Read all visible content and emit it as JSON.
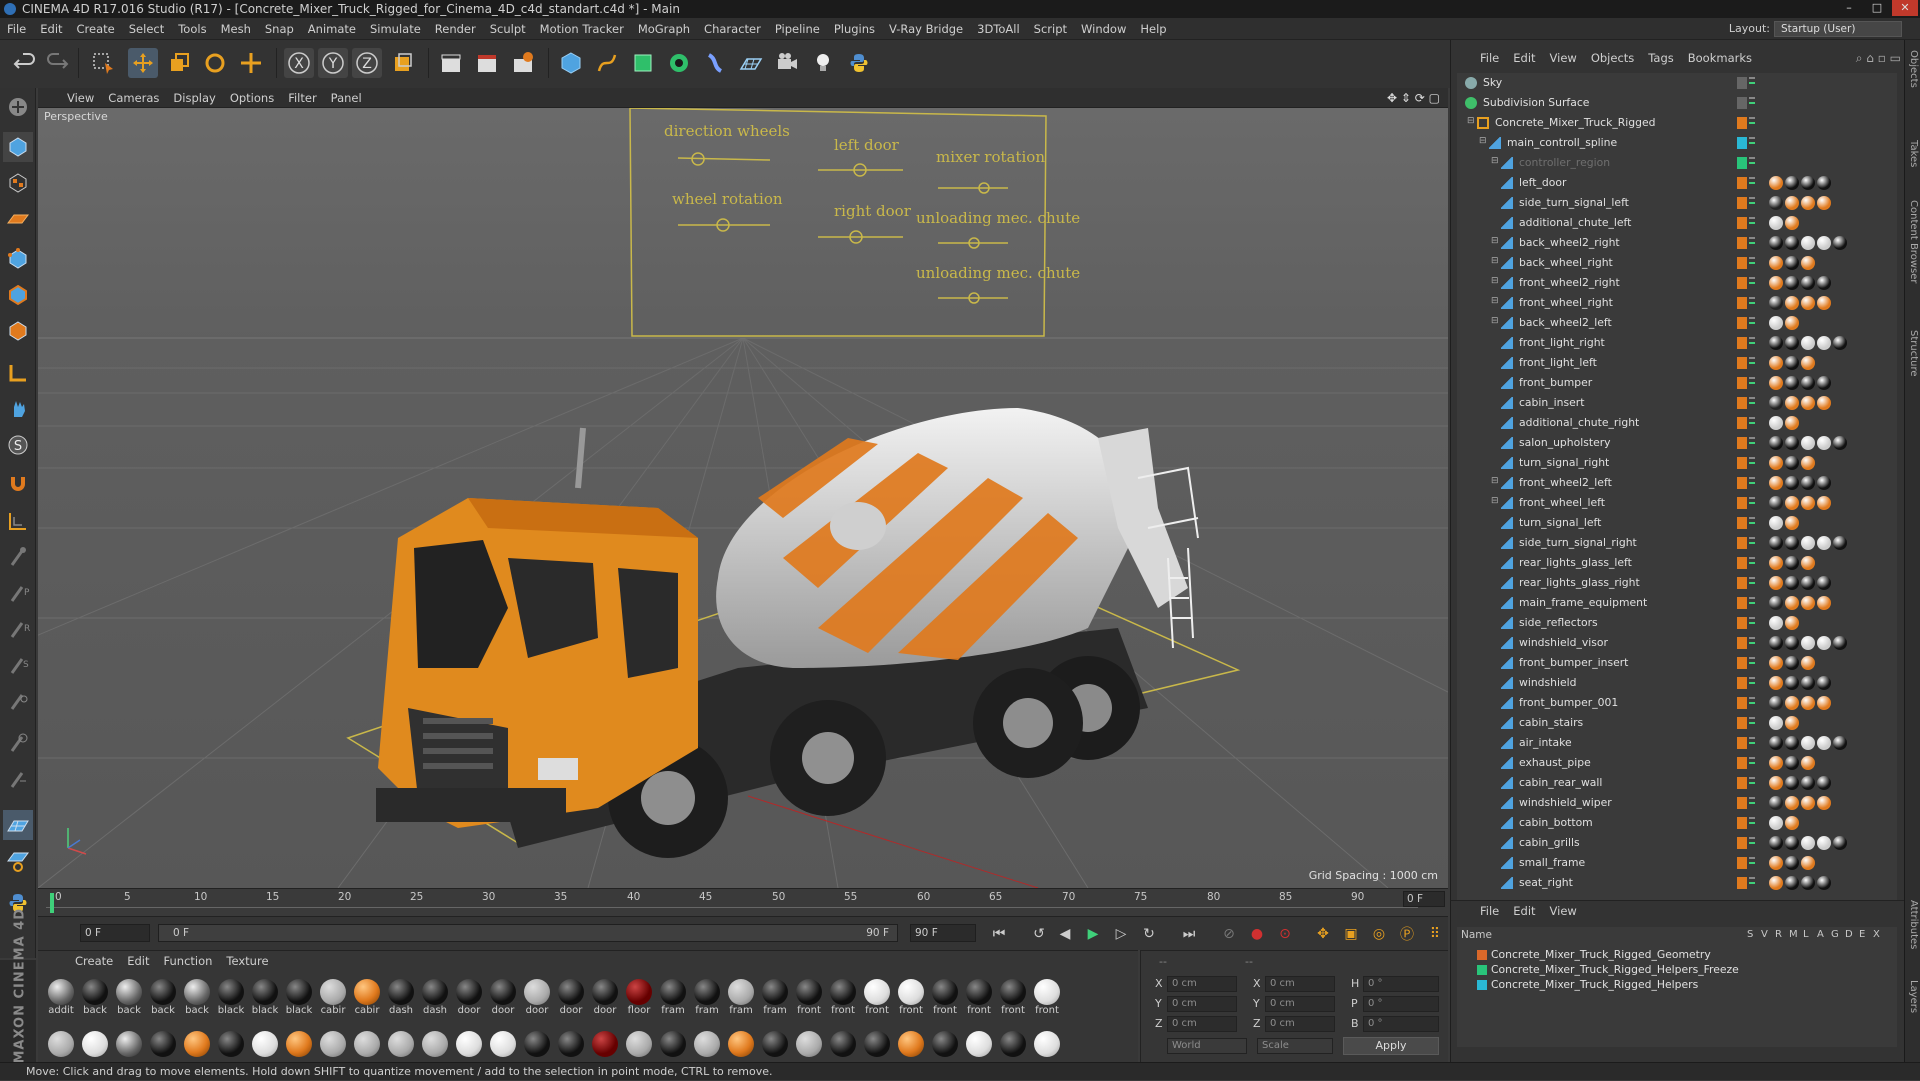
{
  "window": {
    "title": "CINEMA 4D R17.016 Studio (R17) - [Concrete_Mixer_Truck_Rigged_for_Cinema_4D_c4d_standart.c4d *] - Main",
    "controls": [
      "–",
      "□",
      "✕"
    ]
  },
  "menubar": {
    "items": [
      "File",
      "Edit",
      "Create",
      "Select",
      "Tools",
      "Mesh",
      "Snap",
      "Animate",
      "Simulate",
      "Render",
      "Sculpt",
      "Motion Tracker",
      "MoGraph",
      "Character",
      "Pipeline",
      "Plugins",
      "V-Ray Bridge",
      "3DToAll",
      "Script",
      "Window",
      "Help"
    ],
    "layout_label": "Layout:",
    "layout_value": "Startup (User)"
  },
  "viewport": {
    "menu": [
      "View",
      "Cameras",
      "Display",
      "Options",
      "Filter",
      "Panel"
    ],
    "label": "Perspective",
    "grid_spacing": "Grid Spacing : 1000 cm",
    "controller_labels": [
      "direction wheels",
      "left door",
      "mixer rotation",
      "wheel rotation",
      "right door",
      "unloading mec. chute",
      "unloading mec. chute"
    ]
  },
  "timeline": {
    "ticks": [
      "0",
      "5",
      "10",
      "15",
      "20",
      "25",
      "30",
      "35",
      "40",
      "45",
      "50",
      "55",
      "60",
      "65",
      "70",
      "75",
      "80",
      "85",
      "90"
    ],
    "current_frame_display": "0 F",
    "start_field": "0 F",
    "range_start": "0 F",
    "range_end": "90 F",
    "end_field": "90 F"
  },
  "materials": {
    "menu": [
      "Create",
      "Edit",
      "Function",
      "Texture"
    ],
    "row1": [
      "addit",
      "back",
      "back",
      "back",
      "back",
      "black",
      "black",
      "black",
      "cabir",
      "cabir",
      "dash",
      "dash",
      "door",
      "door",
      "door",
      "door",
      "door",
      "floor",
      "fram",
      "fram",
      "fram",
      "fram",
      "front",
      "front",
      "front",
      "front",
      "front",
      "front",
      "front",
      "front"
    ],
    "row2": [
      "",
      "",
      "",
      "",
      "",
      "",
      "",
      "",
      "",
      "",
      "",
      "",
      "",
      "",
      "",
      "",
      "",
      "",
      "",
      "",
      "",
      "",
      "",
      "",
      "",
      "",
      "",
      "",
      "",
      ""
    ]
  },
  "coordinates": {
    "rows": [
      {
        "axis": "X",
        "pos": "0 cm",
        "axis2": "X",
        "size": "0 cm",
        "axis3": "H",
        "rot": "0 °"
      },
      {
        "axis": "Y",
        "pos": "0 cm",
        "axis2": "Y",
        "size": "0 cm",
        "axis3": "P",
        "rot": "0 °"
      },
      {
        "axis": "Z",
        "pos": "0 cm",
        "axis2": "Z",
        "size": "0 cm",
        "axis3": "B",
        "rot": "0 °"
      }
    ],
    "mode1": "World",
    "mode2": "Scale",
    "apply": "Apply",
    "header_left": "--",
    "header_mid": "--"
  },
  "objects_panel": {
    "menu": [
      "File",
      "Edit",
      "View",
      "Objects",
      "Tags",
      "Bookmarks"
    ],
    "items": [
      {
        "name": "Sky",
        "depth": 0
      },
      {
        "name": "Subdivision Surface",
        "depth": 0
      },
      {
        "name": "Concrete_Mixer_Truck_Rigged",
        "depth": 1
      },
      {
        "name": "main_controll_spline",
        "depth": 2
      },
      {
        "name": "controller_region",
        "depth": 3
      },
      {
        "name": "left_door",
        "depth": 3
      },
      {
        "name": "side_turn_signal_left",
        "depth": 3
      },
      {
        "name": "additional_chute_left",
        "depth": 3
      },
      {
        "name": "back_wheel2_right",
        "depth": 3
      },
      {
        "name": "back_wheel_right",
        "depth": 3
      },
      {
        "name": "front_wheel2_right",
        "depth": 3
      },
      {
        "name": "front_wheel_right",
        "depth": 3
      },
      {
        "name": "back_wheel2_left",
        "depth": 3
      },
      {
        "name": "front_light_right",
        "depth": 3
      },
      {
        "name": "front_light_left",
        "depth": 3
      },
      {
        "name": "front_bumper",
        "depth": 3
      },
      {
        "name": "cabin_insert",
        "depth": 3
      },
      {
        "name": "additional_chute_right",
        "depth": 3
      },
      {
        "name": "salon_upholstery",
        "depth": 3
      },
      {
        "name": "turn_signal_right",
        "depth": 3
      },
      {
        "name": "front_wheel2_left",
        "depth": 3
      },
      {
        "name": "front_wheel_left",
        "depth": 3
      },
      {
        "name": "turn_signal_left",
        "depth": 3
      },
      {
        "name": "side_turn_signal_right",
        "depth": 3
      },
      {
        "name": "rear_lights_glass_left",
        "depth": 3
      },
      {
        "name": "rear_lights_glass_right",
        "depth": 3
      },
      {
        "name": "main_frame_equipment",
        "depth": 3
      },
      {
        "name": "side_reflectors",
        "depth": 3
      },
      {
        "name": "windshield_visor",
        "depth": 3
      },
      {
        "name": "front_bumper_insert",
        "depth": 3
      },
      {
        "name": "windshield",
        "depth": 3
      },
      {
        "name": "front_bumper_001",
        "depth": 3
      },
      {
        "name": "cabin_stairs",
        "depth": 3
      },
      {
        "name": "air_intake",
        "depth": 3
      },
      {
        "name": "exhaust_pipe",
        "depth": 3
      },
      {
        "name": "cabin_rear_wall",
        "depth": 3
      },
      {
        "name": "windshield_wiper",
        "depth": 3
      },
      {
        "name": "cabin_bottom",
        "depth": 3
      },
      {
        "name": "cabin_grills",
        "depth": 3
      },
      {
        "name": "small_frame",
        "depth": 3
      },
      {
        "name": "seat_right",
        "depth": 3
      }
    ]
  },
  "layers_panel": {
    "menu": [
      "File",
      "Edit",
      "View"
    ],
    "columns": [
      "Name",
      "S",
      "V",
      "R",
      "M",
      "L",
      "A",
      "G",
      "D",
      "E",
      "X"
    ],
    "items": [
      {
        "name": "Concrete_Mixer_Truck_Rigged_Geometry",
        "color": "#d9682a"
      },
      {
        "name": "Concrete_Mixer_Truck_Rigged_Helpers_Freeze",
        "color": "#29c47a"
      },
      {
        "name": "Concrete_Mixer_Truck_Rigged_Helpers",
        "color": "#2ab8d4"
      }
    ]
  },
  "right_dock_tabs": [
    "Objects",
    "Takes",
    "Content Browser",
    "Structure",
    "Attributes",
    "Layers"
  ],
  "status": "Move: Click and drag to move elements. Hold down SHIFT to quantize movement / add to the selection in point mode, CTRL to remove.",
  "maxon_text": "MAXON CINEMA 4D",
  "colors": {
    "accent_orange": "#e07a1e",
    "selected_blue": "#3b8fd8"
  }
}
